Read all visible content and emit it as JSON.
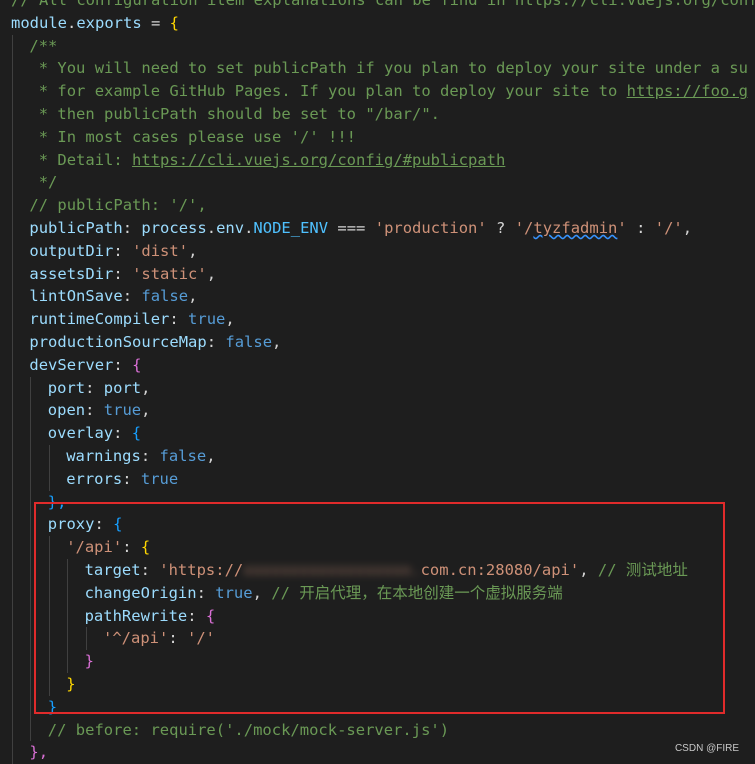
{
  "editor": {
    "lines": [
      {
        "indent": 0,
        "tokens": [
          {
            "t": "// All configuration item explanations can be find in https://cli.vuejs.org/config",
            "c": "t-comment"
          }
        ]
      },
      {
        "indent": 0,
        "tokens": [
          {
            "t": "module",
            "c": "t-var"
          },
          {
            "t": ".",
            "c": "t-punc"
          },
          {
            "t": "exports",
            "c": "t-var"
          },
          {
            "t": " = ",
            "c": "t-punc"
          },
          {
            "t": "{",
            "c": "t-brace1"
          }
        ]
      },
      {
        "indent": 1,
        "tokens": [
          {
            "t": "/**",
            "c": "t-comment"
          }
        ]
      },
      {
        "indent": 1,
        "tokens": [
          {
            "t": " * You will need to set publicPath if you plan to deploy your site under a su",
            "c": "t-comment"
          }
        ]
      },
      {
        "indent": 1,
        "tokens": [
          {
            "t": " * for example GitHub Pages. If you plan to deploy your site to ",
            "c": "t-comment"
          },
          {
            "t": "https://foo.g",
            "c": "t-link"
          }
        ]
      },
      {
        "indent": 1,
        "tokens": [
          {
            "t": " * then publicPath should be set to \"/bar/\".",
            "c": "t-comment"
          }
        ]
      },
      {
        "indent": 1,
        "tokens": [
          {
            "t": " * In most cases please use '/' !!!",
            "c": "t-comment"
          }
        ]
      },
      {
        "indent": 1,
        "tokens": [
          {
            "t": " * Detail: ",
            "c": "t-comment"
          },
          {
            "t": "https://cli.vuejs.org/config/#publicpath",
            "c": "t-link"
          }
        ]
      },
      {
        "indent": 1,
        "tokens": [
          {
            "t": " */",
            "c": "t-comment"
          }
        ]
      },
      {
        "indent": 1,
        "tokens": [
          {
            "t": "// publicPath: '/',",
            "c": "t-comment"
          }
        ]
      },
      {
        "indent": 1,
        "tokens": [
          {
            "t": "publicPath",
            "c": "t-var"
          },
          {
            "t": ": ",
            "c": "t-punc"
          },
          {
            "t": "process",
            "c": "t-var"
          },
          {
            "t": ".",
            "c": "t-punc"
          },
          {
            "t": "env",
            "c": "t-var"
          },
          {
            "t": ".",
            "c": "t-punc"
          },
          {
            "t": "NODE_ENV",
            "c": "t-const"
          },
          {
            "t": " === ",
            "c": "t-punc"
          },
          {
            "t": "'production'",
            "c": "t-str"
          },
          {
            "t": " ? ",
            "c": "t-punc"
          },
          {
            "t": "'/",
            "c": "t-str"
          },
          {
            "t": "tyzfadmin",
            "c": "t-str t-squiggle"
          },
          {
            "t": "'",
            "c": "t-str"
          },
          {
            "t": " : ",
            "c": "t-punc"
          },
          {
            "t": "'/'",
            "c": "t-str"
          },
          {
            "t": ",",
            "c": "t-punc"
          }
        ]
      },
      {
        "indent": 1,
        "tokens": [
          {
            "t": "outputDir",
            "c": "t-var"
          },
          {
            "t": ": ",
            "c": "t-punc"
          },
          {
            "t": "'dist'",
            "c": "t-str"
          },
          {
            "t": ",",
            "c": "t-punc"
          }
        ]
      },
      {
        "indent": 1,
        "tokens": [
          {
            "t": "assetsDir",
            "c": "t-var"
          },
          {
            "t": ": ",
            "c": "t-punc"
          },
          {
            "t": "'static'",
            "c": "t-str"
          },
          {
            "t": ",",
            "c": "t-punc"
          }
        ]
      },
      {
        "indent": 1,
        "tokens": [
          {
            "t": "lintOnSave",
            "c": "t-var"
          },
          {
            "t": ": ",
            "c": "t-punc"
          },
          {
            "t": "false",
            "c": "t-kw"
          },
          {
            "t": ",",
            "c": "t-punc"
          }
        ]
      },
      {
        "indent": 1,
        "tokens": [
          {
            "t": "runtimeCompiler",
            "c": "t-var"
          },
          {
            "t": ": ",
            "c": "t-punc"
          },
          {
            "t": "true",
            "c": "t-kw"
          },
          {
            "t": ",",
            "c": "t-punc"
          }
        ]
      },
      {
        "indent": 1,
        "tokens": [
          {
            "t": "productionSourceMap",
            "c": "t-var"
          },
          {
            "t": ": ",
            "c": "t-punc"
          },
          {
            "t": "false",
            "c": "t-kw"
          },
          {
            "t": ",",
            "c": "t-punc"
          }
        ]
      },
      {
        "indent": 1,
        "tokens": [
          {
            "t": "devServer",
            "c": "t-var"
          },
          {
            "t": ": ",
            "c": "t-punc"
          },
          {
            "t": "{",
            "c": "t-brace2"
          }
        ]
      },
      {
        "indent": 2,
        "tokens": [
          {
            "t": "port",
            "c": "t-var"
          },
          {
            "t": ": ",
            "c": "t-punc"
          },
          {
            "t": "port",
            "c": "t-var"
          },
          {
            "t": ",",
            "c": "t-punc"
          }
        ]
      },
      {
        "indent": 2,
        "tokens": [
          {
            "t": "open",
            "c": "t-var"
          },
          {
            "t": ": ",
            "c": "t-punc"
          },
          {
            "t": "true",
            "c": "t-kw"
          },
          {
            "t": ",",
            "c": "t-punc"
          }
        ]
      },
      {
        "indent": 2,
        "tokens": [
          {
            "t": "overlay",
            "c": "t-var"
          },
          {
            "t": ": ",
            "c": "t-punc"
          },
          {
            "t": "{",
            "c": "t-brace3"
          }
        ]
      },
      {
        "indent": 3,
        "tokens": [
          {
            "t": "warnings",
            "c": "t-var"
          },
          {
            "t": ": ",
            "c": "t-punc"
          },
          {
            "t": "false",
            "c": "t-kw"
          },
          {
            "t": ",",
            "c": "t-punc"
          }
        ]
      },
      {
        "indent": 3,
        "tokens": [
          {
            "t": "errors",
            "c": "t-var"
          },
          {
            "t": ": ",
            "c": "t-punc"
          },
          {
            "t": "true",
            "c": "t-kw"
          }
        ]
      },
      {
        "indent": 2,
        "tokens": [
          {
            "t": "},",
            "c": "t-brace3"
          }
        ]
      },
      {
        "indent": 2,
        "tokens": [
          {
            "t": "proxy",
            "c": "t-var"
          },
          {
            "t": ": ",
            "c": "t-punc"
          },
          {
            "t": "{",
            "c": "t-brace3"
          }
        ]
      },
      {
        "indent": 3,
        "tokens": [
          {
            "t": "'/api'",
            "c": "t-str"
          },
          {
            "t": ": ",
            "c": "t-punc"
          },
          {
            "t": "{",
            "c": "t-brace1"
          }
        ]
      },
      {
        "indent": 4,
        "tokens": [
          {
            "t": "target",
            "c": "t-var"
          },
          {
            "t": ": ",
            "c": "t-punc"
          },
          {
            "t": "'https://",
            "c": "t-str"
          },
          {
            "t": "xxxxxxxxxxxxxxxxxx.",
            "c": "t-blur"
          },
          {
            "t": "com.cn:28080/api'",
            "c": "t-str"
          },
          {
            "t": ", ",
            "c": "t-punc"
          },
          {
            "t": "// 测试地址",
            "c": "t-comment"
          }
        ]
      },
      {
        "indent": 4,
        "tokens": [
          {
            "t": "changeOrigin",
            "c": "t-var"
          },
          {
            "t": ": ",
            "c": "t-punc"
          },
          {
            "t": "true",
            "c": "t-kw"
          },
          {
            "t": ", ",
            "c": "t-punc"
          },
          {
            "t": "// 开启代理，在本地创建一个虚拟服务端",
            "c": "t-comment"
          }
        ]
      },
      {
        "indent": 4,
        "tokens": [
          {
            "t": "pathRewrite",
            "c": "t-var"
          },
          {
            "t": ": ",
            "c": "t-punc"
          },
          {
            "t": "{",
            "c": "t-brace2"
          }
        ]
      },
      {
        "indent": 5,
        "tokens": [
          {
            "t": "'^/api'",
            "c": "t-str"
          },
          {
            "t": ": ",
            "c": "t-punc"
          },
          {
            "t": "'/'",
            "c": "t-str"
          }
        ]
      },
      {
        "indent": 4,
        "tokens": [
          {
            "t": "}",
            "c": "t-brace2"
          }
        ]
      },
      {
        "indent": 3,
        "tokens": [
          {
            "t": "}",
            "c": "t-brace1"
          }
        ]
      },
      {
        "indent": 2,
        "tokens": [
          {
            "t": "}",
            "c": "t-brace3"
          }
        ]
      },
      {
        "indent": 2,
        "tokens": [
          {
            "t": "// before: require('./mock/mock-server.js')",
            "c": "t-comment"
          }
        ]
      },
      {
        "indent": 1,
        "tokens": [
          {
            "t": "},",
            "c": "t-brace2"
          }
        ]
      }
    ]
  },
  "watermark": "CSDN @FIRE"
}
